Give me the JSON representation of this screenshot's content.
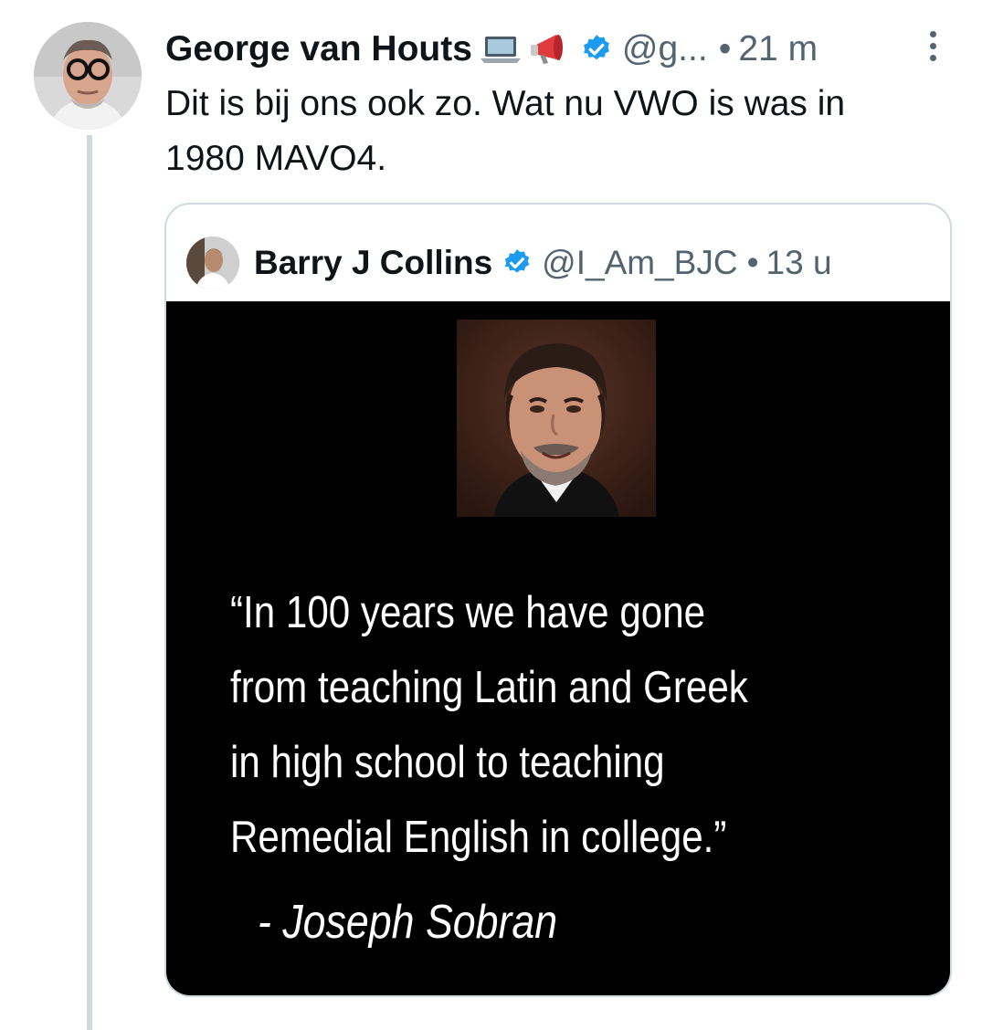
{
  "tweet": {
    "author_name": "George van Houts",
    "author_emojis": [
      "laptop-icon",
      "megaphone-icon"
    ],
    "verified": true,
    "handle": "@g...",
    "separator": "•",
    "time": "21 m",
    "text_line1": "Dit is bij ons ook zo. Wat nu VWO is was in",
    "text_line2": "1980 MAVO4."
  },
  "quoted_tweet": {
    "author_name": "Barry J Collins",
    "verified": true,
    "handle": "@I_Am_BJC",
    "separator": "•",
    "time": "13 u",
    "media": {
      "quote_lines": [
        "“In 100 years we have gone",
        "from teaching Latin and Greek",
        "in high school to teaching",
        "Remedial English in college.”"
      ],
      "attribution": "- Joseph Sobran"
    }
  },
  "colors": {
    "text": "#0f1419",
    "secondary": "#536471",
    "verified_blue": "#1d9bf0",
    "thread_line": "#cfd9de",
    "card_border": "#cfd9de",
    "media_background": "#000000"
  }
}
